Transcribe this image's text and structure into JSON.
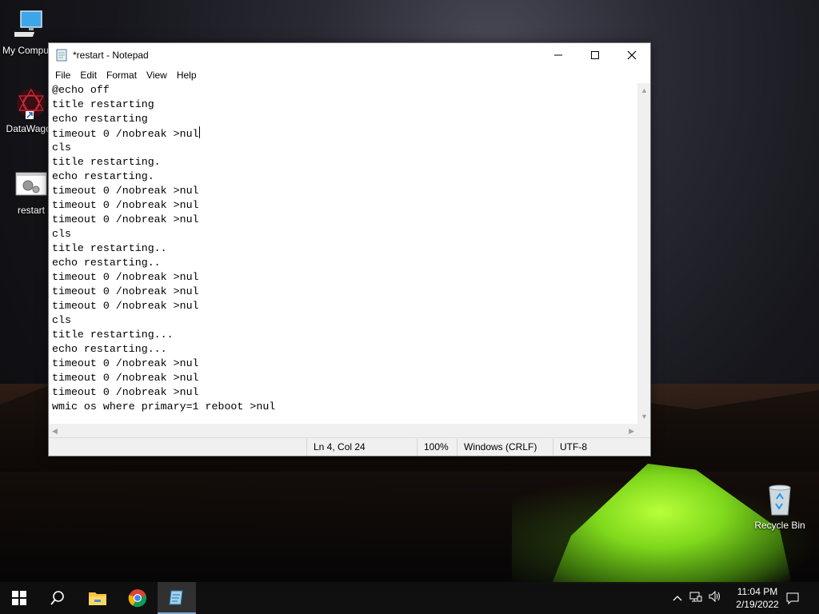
{
  "desktop": {
    "icons": [
      {
        "label": "My Computer"
      },
      {
        "label": "DataWagon"
      },
      {
        "label": "restart"
      },
      {
        "label": "Recycle Bin"
      }
    ]
  },
  "window": {
    "title": "*restart - Notepad",
    "menu": [
      "File",
      "Edit",
      "Format",
      "View",
      "Help"
    ],
    "lines": [
      "@echo off",
      "title restarting",
      "echo restarting",
      "timeout 0 /nobreak >nul",
      "cls",
      "title restarting.",
      "echo restarting.",
      "timeout 0 /nobreak >nul",
      "timeout 0 /nobreak >nul",
      "timeout 0 /nobreak >nul",
      "cls",
      "title restarting..",
      "echo restarting..",
      "timeout 0 /nobreak >nul",
      "timeout 0 /nobreak >nul",
      "timeout 0 /nobreak >nul",
      "cls",
      "title restarting...",
      "echo restarting...",
      "timeout 0 /nobreak >nul",
      "timeout 0 /nobreak >nul",
      "timeout 0 /nobreak >nul",
      "wmic os where primary=1 reboot >nul"
    ],
    "status": {
      "position": "Ln 4, Col 24",
      "zoom": "100%",
      "line_ending": "Windows (CRLF)",
      "encoding": "UTF-8"
    }
  },
  "taskbar": {
    "time": "11:04 PM",
    "date": "2/19/2022",
    "icons": [
      "windows-start-icon",
      "search-icon",
      "file-explorer-icon",
      "chrome-icon",
      "notepad-icon"
    ]
  }
}
